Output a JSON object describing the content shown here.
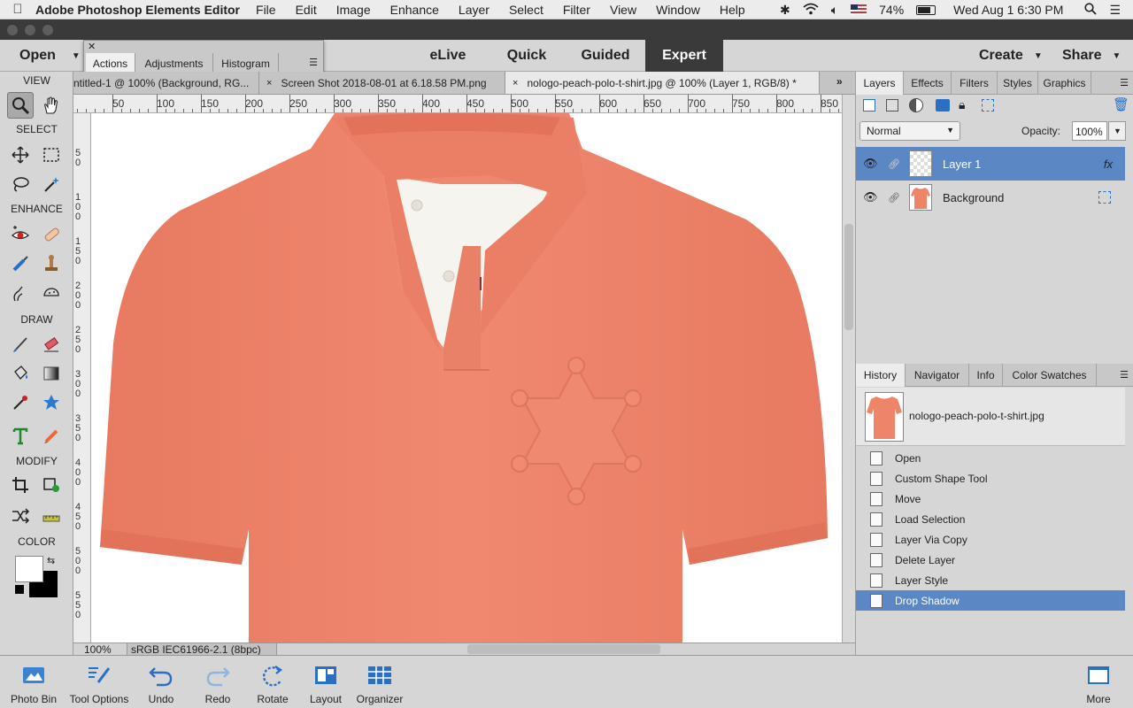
{
  "menubar": {
    "app_name": "Adobe Photoshop Elements Editor",
    "menus": [
      "File",
      "Edit",
      "Image",
      "Enhance",
      "Layer",
      "Select",
      "Filter",
      "View",
      "Window",
      "Help"
    ],
    "battery": "74%",
    "clock": "Wed Aug 1  6:30 PM"
  },
  "modebar": {
    "open_label": "Open",
    "modes": [
      "eLive",
      "Quick",
      "Guided",
      "Expert"
    ],
    "active_mode": "Expert",
    "create_label": "Create",
    "share_label": "Share"
  },
  "actions_panel": {
    "tabs": [
      "Actions",
      "Adjustments",
      "Histogram"
    ],
    "active_tab": "Actions"
  },
  "toolbox": {
    "sections": [
      "VIEW",
      "SELECT",
      "ENHANCE",
      "DRAW",
      "MODIFY",
      "COLOR"
    ]
  },
  "document_tabs": [
    {
      "label": "ntitled-1 @ 100% (Background, RG...",
      "close": "×"
    },
    {
      "label": "Screen Shot 2018-08-01 at 6.18.58 PM.png",
      "close": "×"
    },
    {
      "label": "nologo-peach-polo-t-shirt.jpg @ 100% (Layer 1, RGB/8) *",
      "close": "×"
    }
  ],
  "ruler": {
    "h_labels": [
      "50",
      "100",
      "150",
      "200",
      "250",
      "300",
      "350",
      "400",
      "450",
      "500",
      "550",
      "600",
      "650",
      "700",
      "750",
      "800",
      "850"
    ],
    "v_labels": [
      "5\n0",
      "1\n0\n0",
      "1\n5\n0",
      "2\n0\n0",
      "2\n5\n0",
      "3\n0\n0",
      "3\n5\n0",
      "4\n0\n0",
      "4\n5\n0",
      "5\n0\n0",
      "5\n5\n0"
    ]
  },
  "status": {
    "zoom": "100%",
    "profile": "sRGB IEC61966-2.1 (8bpc)"
  },
  "layers_panel": {
    "tabs": [
      "Layers",
      "Effects",
      "Filters",
      "Styles",
      "Graphics"
    ],
    "active_tab": "Layers",
    "blend_mode": "Normal",
    "opacity_label": "Opacity:",
    "opacity_value": "100%",
    "layers": [
      {
        "name": "Layer 1",
        "selected": true,
        "fx": "fx"
      },
      {
        "name": "Background",
        "selected": false,
        "fx": ""
      }
    ]
  },
  "history_panel": {
    "tabs": [
      "History",
      "Navigator",
      "Info",
      "Color Swatches"
    ],
    "active_tab": "History",
    "file_name": "nologo-peach-polo-t-shirt.jpg",
    "steps": [
      "Open",
      "Custom Shape Tool",
      "Move",
      "Load Selection",
      "Layer Via Copy",
      "Delete Layer",
      "Layer Style",
      "Drop Shadow"
    ],
    "selected_step": "Drop Shadow"
  },
  "bottombar": {
    "buttons": [
      "Photo Bin",
      "Tool Options",
      "Undo",
      "Redo",
      "Rotate",
      "Layout",
      "Organizer"
    ],
    "more_label": "More"
  },
  "colors": {
    "shirt": "#ee8468",
    "selection": "#5b87c5",
    "panel_bg": "#d6d6d6"
  }
}
